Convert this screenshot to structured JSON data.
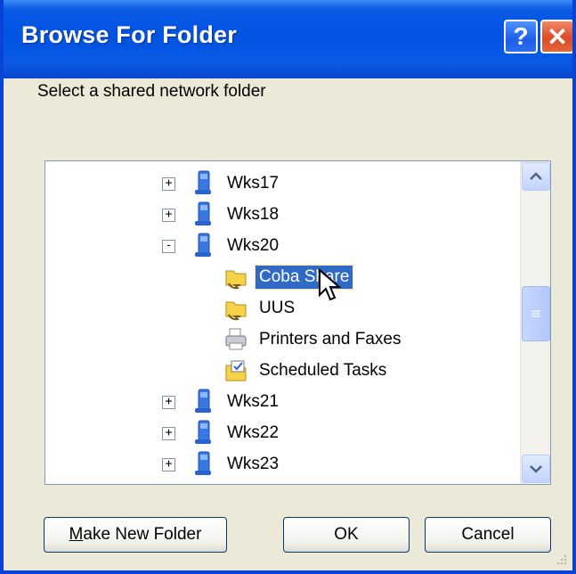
{
  "window": {
    "title": "Browse For Folder",
    "help_glyph": "?",
    "close_glyph": "✕"
  },
  "prompt": "Select a shared network folder",
  "tree": {
    "items": [
      {
        "label": "Wks17",
        "icon": "computer-icon",
        "expander": "+"
      },
      {
        "label": "Wks18",
        "icon": "computer-icon",
        "expander": "+"
      },
      {
        "label": "Wks20",
        "icon": "computer-icon",
        "expander": "-"
      },
      {
        "label": "Coba Share",
        "icon": "shared-folder-icon",
        "selected": true
      },
      {
        "label": "UUS",
        "icon": "shared-folder-icon"
      },
      {
        "label": "Printers and Faxes",
        "icon": "printer-icon"
      },
      {
        "label": "Scheduled Tasks",
        "icon": "scheduled-tasks-icon"
      },
      {
        "label": "Wks21",
        "icon": "computer-icon",
        "expander": "+"
      },
      {
        "label": "Wks22",
        "icon": "computer-icon",
        "expander": "+"
      },
      {
        "label": "Wks23",
        "icon": "computer-icon",
        "expander": "+"
      }
    ]
  },
  "buttons": {
    "make_new_folder_prefix": "M",
    "make_new_folder_rest": "ake New Folder",
    "ok": "OK",
    "cancel": "Cancel"
  },
  "colors": {
    "titlebar": "#0a5ae5",
    "selection": "#316ac5",
    "dialog_bg": "#ece9d8"
  }
}
